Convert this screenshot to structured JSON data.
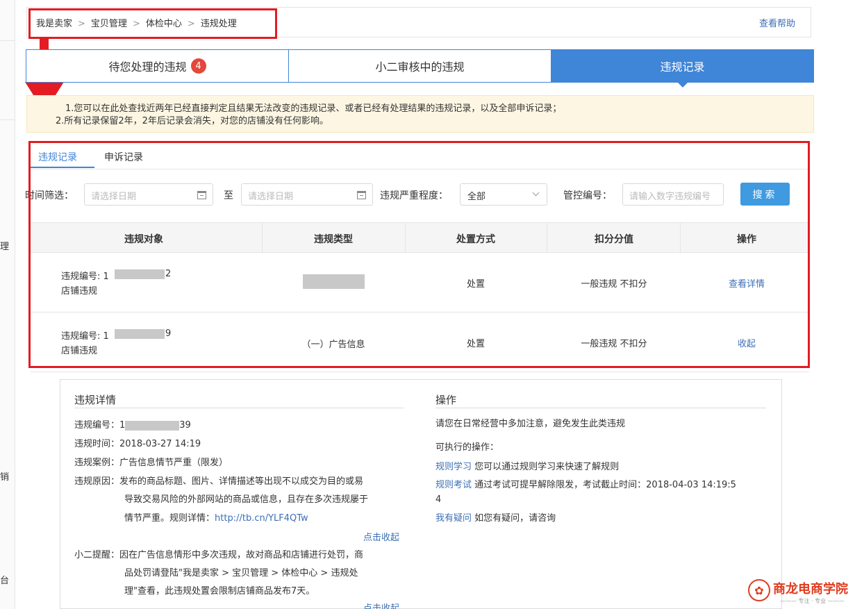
{
  "sidebar": {
    "chars": [
      "理",
      "销",
      "台"
    ]
  },
  "breadcrumb": {
    "items": [
      "我是卖家",
      "宝贝管理",
      "体检中心",
      "违规处理"
    ],
    "separator": ">",
    "help": "查看帮助"
  },
  "tabs": [
    {
      "label": "待您处理的违规",
      "badge": "4"
    },
    {
      "label": "小二审核中的违规"
    },
    {
      "label": "违规记录"
    }
  ],
  "notice": {
    "line1": "1.您可以在此处查找近两年已经直接判定且结果无法改变的违规记录、或者已经有处理结果的违规记录，以及全部申诉记录；",
    "line2": "2.所有记录保留2年，2年后记录会消失，对您的店铺没有任何影响。"
  },
  "sub_tabs": [
    "违规记录",
    "申诉记录"
  ],
  "filters": {
    "time_label": "时间筛选：",
    "date_placeholder_from": "请选择日期",
    "to_label": "至",
    "date_placeholder_to": "请选择日期",
    "severity_label": "违规严重程度：",
    "severity_value": "全部",
    "id_label": "管控编号：",
    "id_placeholder": "请输入数字违规编号",
    "search": "搜索"
  },
  "table": {
    "headers": [
      "违规对象",
      "违规类型",
      "处置方式",
      "扣分分值",
      "操作"
    ],
    "rows": [
      {
        "id_prefix": "违规编号: 1",
        "id_suffix": "2",
        "object_type": "店铺违规",
        "type": "",
        "handling": "处置",
        "score": "一般违规 不扣分",
        "action": "查看详情"
      },
      {
        "id_prefix": "违规编号: 1",
        "id_suffix": "9",
        "object_type": "店铺违规",
        "type": "（一）广告信息",
        "handling": "处置",
        "score": "一般违规 不扣分",
        "action": "收起"
      }
    ]
  },
  "detail": {
    "title": "违规详情",
    "id_label": "违规编号：1",
    "id_suffix": "39",
    "time": "违规时间：2018-03-27 14:19",
    "case": "违规案例：广告信息情节严重（限发）",
    "reason_1": "违规原因：发布的商品标题、图片、详情描述等出现不以成交为目的或易",
    "reason_2": "导致交易风险的外部网站的商品或信息，且存在多次违规屡于",
    "reason_3": "情节严重。规则详情：",
    "reason_link": "http://tb.cn/YLF4QTw",
    "collapse": "点击收起",
    "tip_1": "小二提醒：因在广告信息情形中多次违规，故对商品和店铺进行处罚，商",
    "tip_2": "品处罚请登陆\"我是卖家 > 宝贝管理 > 体检中心 > 违规处",
    "tip_3": "理\"查看，此违规处置会限制店铺商品发布7天。",
    "collapse_2": "点击收起"
  },
  "operation": {
    "title": "操作",
    "notice": "请您在日常经营中多加注意，避免发生此类违规",
    "available": "可执行的操作：",
    "item1_link": "规则学习",
    "item1_text": "您可以通过规则学习来快速了解规则",
    "item2_link": "规则考试",
    "item2_text": "通过考试可提早解除限发，考试截止时间：2018-04-03 14:19:5",
    "item2_text_cont": "4",
    "item3_link": "我有疑问",
    "item3_text": "如您有疑问，请咨询"
  },
  "watermark": {
    "title": "商龙电商学院",
    "subtitle": "——— 专注 · 专业 ———"
  },
  "colors": {
    "accent": "#3f85d8",
    "highlight_red": "#e31b23",
    "badge": "#e4473b",
    "link": "#3d6fb6"
  }
}
